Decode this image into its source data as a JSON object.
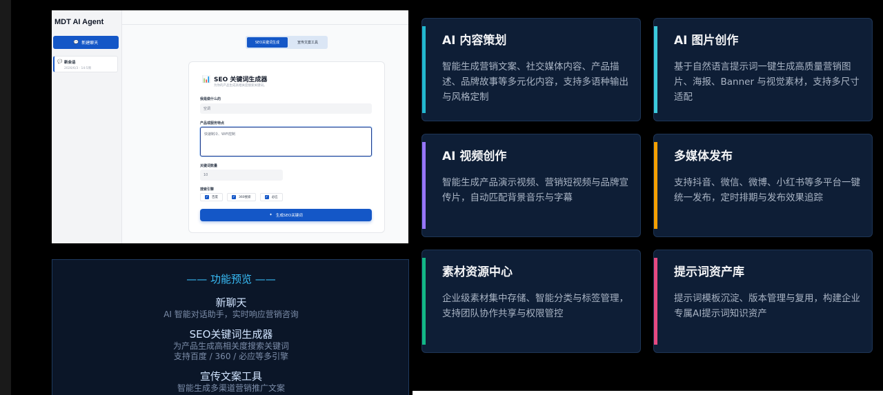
{
  "app": {
    "brand": "MDT AI Agent",
    "new_chat_label": "新建聊天",
    "session": {
      "title": "新会话",
      "date": "2026/6/3 · 14:5周"
    },
    "tabs": [
      {
        "label": "SEO关键词生成",
        "active": true
      },
      {
        "label": "宣传文案工具",
        "active": false
      }
    ],
    "seo_card": {
      "title": "SEO 关键词生成器",
      "subtitle": "为你的产品生成高相关度搜索关键词。",
      "field_product_label": "我是做什么的",
      "field_product_value": "空调",
      "field_features_label": "产品或服务特点",
      "field_features_value": "快速制冷、WiFi控制",
      "field_count_label": "关键词数量",
      "field_count_value": "10",
      "field_engines_label": "搜索引擎",
      "engines": [
        "百度",
        "360搜索",
        "必应"
      ],
      "generate_label": "生成SEO关键词"
    }
  },
  "preview": {
    "heading": "—— 功能预览 ——",
    "items": [
      {
        "title": "新聊天",
        "desc": [
          "AI 智能对话助手，实时响应营销咨询"
        ]
      },
      {
        "title": "SEO关键词生成器",
        "desc": [
          "为产品生成高相关度搜索关键词",
          "支持百度 / 360 / 必应等多引擎"
        ]
      },
      {
        "title": "宣传文案工具",
        "desc": [
          "智能生成多渠道营销推广文案"
        ]
      }
    ]
  },
  "features": [
    {
      "title": "AI 内容策划",
      "desc": "智能生成营销文案、社交媒体内容、产品描述、品牌故事等多元化内容，支持多语种输出与风格定制",
      "accent": "#22b8cf"
    },
    {
      "title": "AI 图片创作",
      "desc": "基于自然语言提示词一键生成高质量营销图片、海报、Banner 与视觉素材，支持多尺寸适配",
      "accent": "#3bc9db"
    },
    {
      "title": "AI 视频创作",
      "desc": "智能生成产品演示视频、营销短视频与品牌宣传片，自动匹配背景音乐与字幕",
      "accent": "#9775fa"
    },
    {
      "title": "多媒体发布",
      "desc": "支持抖音、微信、微博、小红书等多平台一键统一发布，定时排期与发布效果追踪",
      "accent": "#f59f00"
    },
    {
      "title": "素材资源中心",
      "desc": "企业级素材集中存储、智能分类与标签管理，支持团队协作共享与权限管控",
      "accent": "#12b886"
    },
    {
      "title": "提示词资产库",
      "desc": "提示词模板沉淀、版本管理与复用，构建企业专属AI提示词知识资产",
      "accent": "#e64980"
    }
  ]
}
